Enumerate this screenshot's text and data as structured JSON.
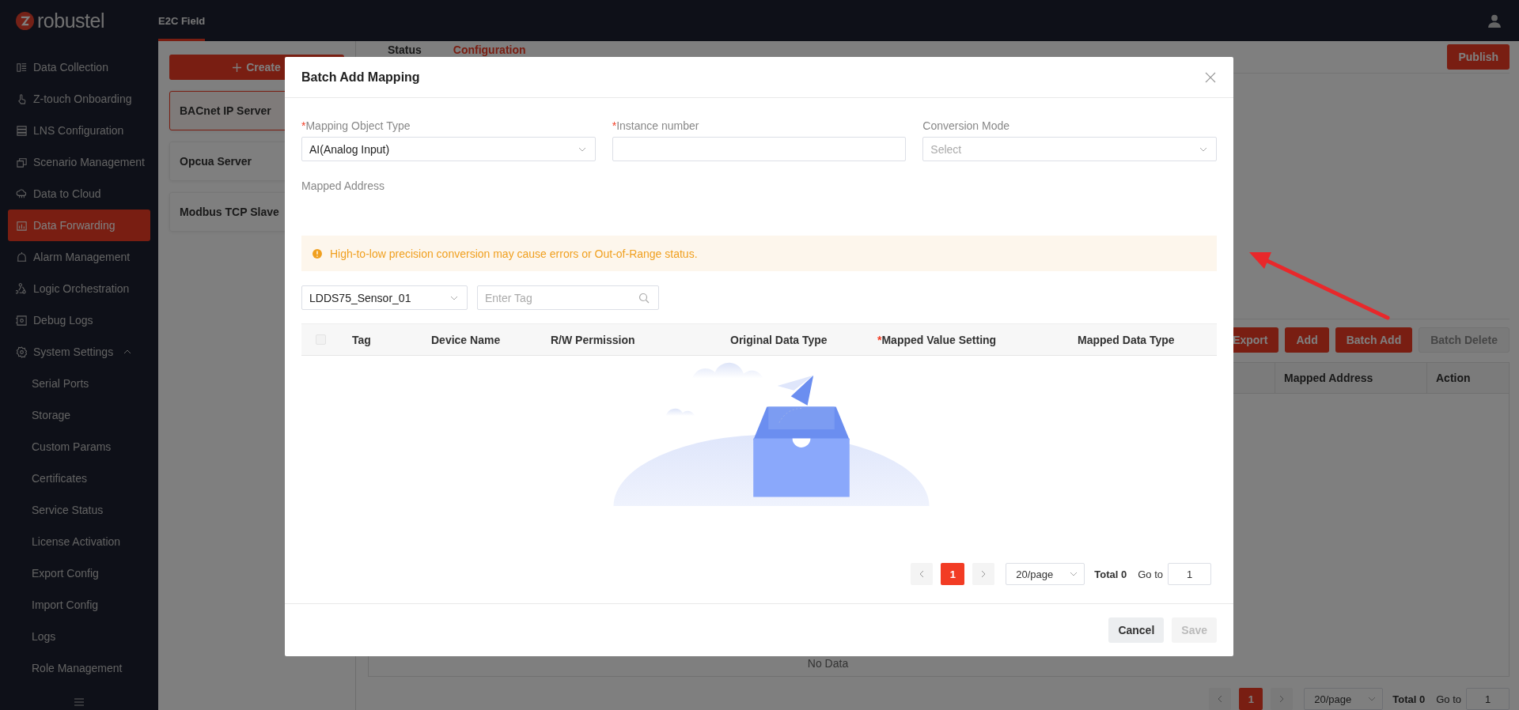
{
  "top_bar": {
    "logo": "robustel",
    "tabs": [
      {
        "label": "E2C Field",
        "selected": true
      }
    ]
  },
  "sidebar": {
    "items": [
      {
        "label": "Data Collection",
        "selected": false
      },
      {
        "label": "Z-touch Onboarding",
        "selected": false
      },
      {
        "label": "LNS Configuration",
        "selected": false
      },
      {
        "label": "Scenario Management",
        "selected": false
      },
      {
        "label": "Data to Cloud",
        "selected": false
      },
      {
        "label": "Data Forwarding",
        "selected": true
      },
      {
        "label": "Alarm Management",
        "selected": false
      },
      {
        "label": "Logic Orchestration",
        "selected": false
      },
      {
        "label": "Debug Logs",
        "selected": false
      },
      {
        "label": "System Settings",
        "selected": false,
        "expanded": true,
        "children": [
          {
            "label": "Serial Ports",
            "selected": false
          },
          {
            "label": "Storage",
            "selected": false
          },
          {
            "label": "Custom Params",
            "selected": false
          },
          {
            "label": "Certificates",
            "selected": false
          },
          {
            "label": "Service Status",
            "selected": false
          },
          {
            "label": "License Activation",
            "selected": false
          },
          {
            "label": "Export Config",
            "selected": false
          },
          {
            "label": "Import Config",
            "selected": false
          },
          {
            "label": "Logs",
            "selected": false
          },
          {
            "label": "Role Management",
            "selected": false
          }
        ]
      }
    ]
  },
  "server_list": {
    "create_button": "Create",
    "items": [
      {
        "label": "BACnet IP Server",
        "selected": true
      },
      {
        "label": "Opcua Server",
        "selected": false
      },
      {
        "label": "Modbus TCP Slave",
        "selected": false
      }
    ]
  },
  "page_tabs": [
    {
      "label": "Status",
      "selected": false
    },
    {
      "label": "Configuration",
      "selected": true
    }
  ],
  "publish_button": "Publish",
  "toolbar_buttons": [
    {
      "label": "Export",
      "disabled": false
    },
    {
      "label": "Add",
      "disabled": false
    },
    {
      "label": "Batch Add",
      "disabled": false
    },
    {
      "label": "Batch Delete",
      "disabled": true
    }
  ],
  "table": {
    "columns": [
      "Mapped Address",
      "Action"
    ],
    "empty_text": "No Data"
  },
  "pagination": {
    "page": "1",
    "page_size": "20/page",
    "total": "Total 0",
    "goto_label": "Go to",
    "goto_value": "1"
  },
  "dialog": {
    "title": "Batch Add Mapping",
    "required_mark": "*",
    "fields": [
      {
        "label": "Mapping Object Type",
        "required": true,
        "kind": "select",
        "value": "AI(Analog Input)"
      },
      {
        "label": "Instance number",
        "required": true,
        "kind": "input"
      },
      {
        "label": "Conversion Mode",
        "required": false,
        "kind": "select",
        "placeholder": "Select"
      }
    ],
    "mapped_address_label": "Mapped Address",
    "warning": "High-to-low precision conversion may cause errors or Out-of-Range status.",
    "device_select": "LDDS75_Sensor_01",
    "tag_search": {
      "placeholder": "Enter Tag"
    },
    "table": {
      "select_all": {
        "checked": false
      },
      "columns": [
        {
          "label": "Tag",
          "required": false
        },
        {
          "label": "Device Name",
          "required": false
        },
        {
          "label": "R/W Permission",
          "required": false
        },
        {
          "label": "Original Data Type",
          "required": false
        },
        {
          "label": "Mapped Value Setting",
          "required": true
        },
        {
          "label": "Mapped Data Type",
          "required": false
        }
      ]
    },
    "pagination": {
      "page": "1",
      "page_size": "20/page",
      "total": "Total 0",
      "goto_label": "Go to",
      "goto_value": "1"
    },
    "buttons": [
      {
        "label": "Cancel",
        "disabled": false
      },
      {
        "label": "Save",
        "disabled": true
      }
    ]
  }
}
